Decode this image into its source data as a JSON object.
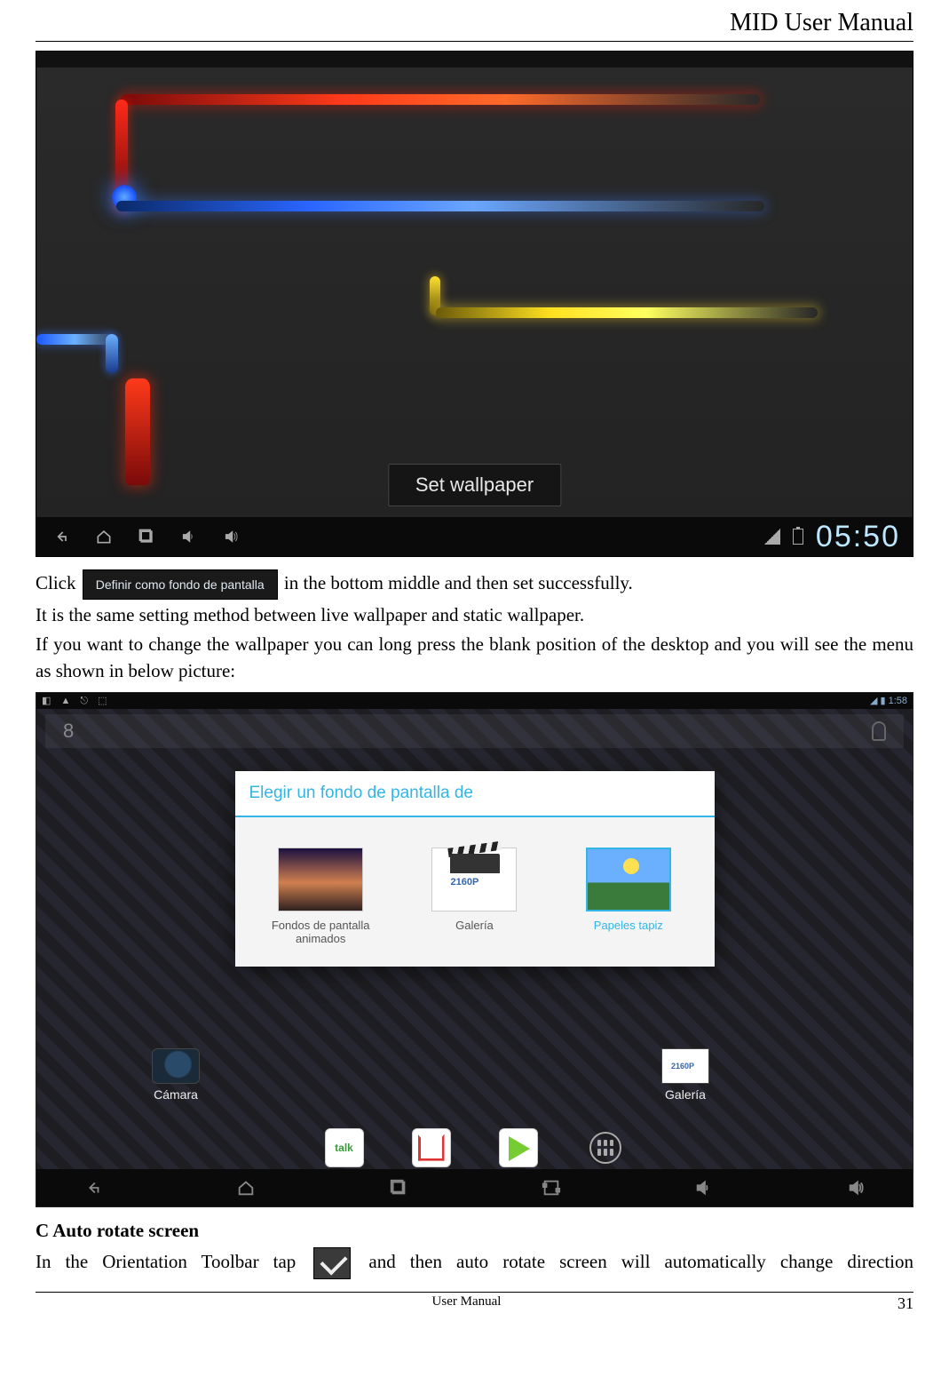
{
  "header_title": "MID User Manual",
  "screenshot1": {
    "button_label": "Set wallpaper",
    "clock": "05:50",
    "nav_icons": [
      "back",
      "home",
      "recent",
      "volume-down",
      "volume-up"
    ]
  },
  "inline_button_label": "Definir como fondo de pantalla",
  "para1_a": "Click ",
  "para1_b": " in the bottom middle and then set successfully.",
  "para2": "It is the same setting method between live wallpaper and static wallpaper.",
  "para3": "If you want to change the wallpaper you can long press the blank position of the desktop and you will see the menu as shown in below picture:",
  "screenshot2": {
    "status_time": "1:58",
    "search_placeholder": "8",
    "dialog_title": "Elegir un fondo de pantalla de",
    "options": [
      {
        "label": "Fondos de pantalla animados"
      },
      {
        "label": "Galería"
      },
      {
        "label": "Papeles tapiz"
      }
    ],
    "bg_icons": [
      {
        "label": "Cámara"
      },
      {
        "label": "Galería"
      }
    ],
    "dock": [
      "talk",
      "gmail",
      "play",
      "apps"
    ],
    "nav_icons": [
      "back",
      "home",
      "recent",
      "screenshot",
      "volume-down",
      "volume-up"
    ]
  },
  "section_c_title": "C Auto rotate screen",
  "section_c_a": "In  the  Orientation  Toolbar  tap ",
  "section_c_b": " and  then  auto  rotate  screen  will  automatically  change  direction",
  "footer_center": "User Manual",
  "footer_page": "31"
}
